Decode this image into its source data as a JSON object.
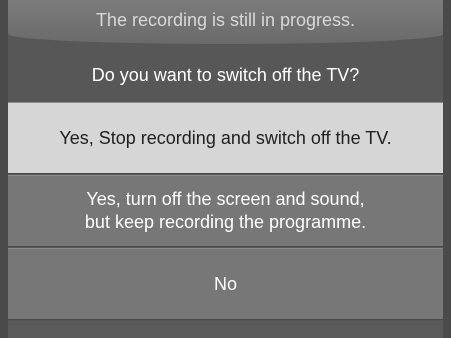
{
  "dialog": {
    "title": "The recording is still in progress.",
    "question": "Do you want to switch off the TV?",
    "options": [
      {
        "label": "Yes, Stop recording and switch off the TV.",
        "selected": true
      },
      {
        "line1": "Yes, turn off the screen and sound,",
        "line2": "but keep recording the programme.",
        "selected": false
      },
      {
        "label": "No",
        "selected": false
      }
    ]
  },
  "colors": {
    "background": "#575757",
    "title_bar": "#737373",
    "selected_option": "#d6d6d6",
    "option": "#777777",
    "text_light": "#ffffff",
    "text_dark": "#202020"
  }
}
